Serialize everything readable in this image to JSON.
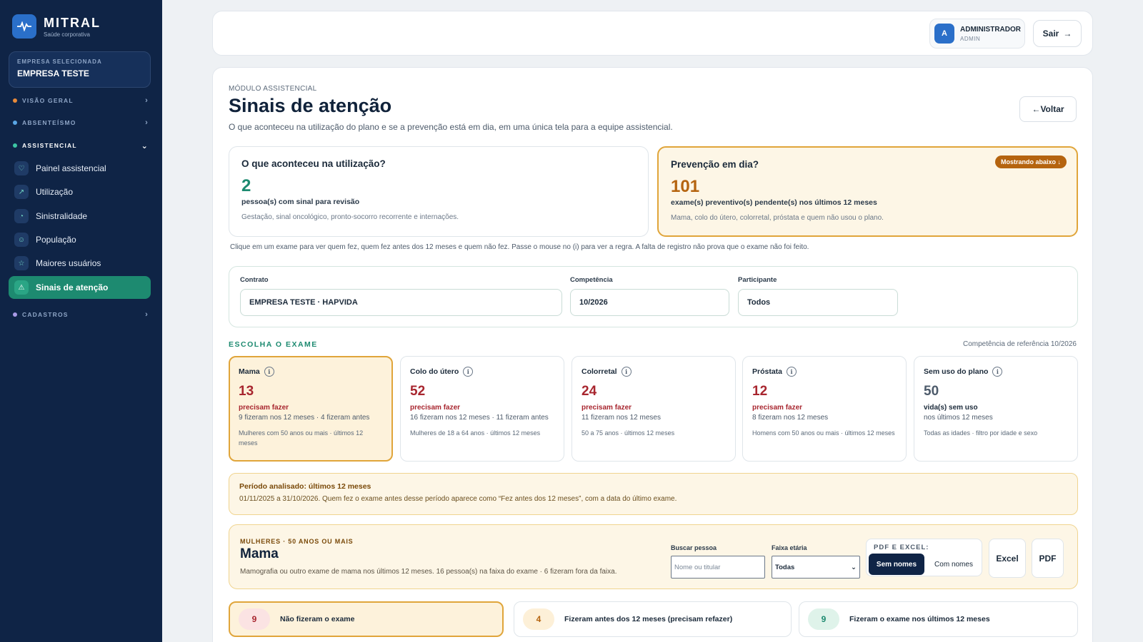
{
  "brand": {
    "name": "MITRAL",
    "subtitle": "Saúde corporativa"
  },
  "company": {
    "caption": "EMPRESA SELECIONADA",
    "name": "EMPRESA TESTE"
  },
  "nav": {
    "sections": {
      "visao_geral": "VISÃO GERAL",
      "absenteismo": "ABSENTEÍSMO",
      "assistencial": "ASSISTENCIAL",
      "cadastros": "CADASTROS"
    },
    "items": [
      {
        "label": "Painel assistencial",
        "icon": "heart-shield-icon"
      },
      {
        "label": "Utilização",
        "icon": "trend-icon"
      },
      {
        "label": "Sinistralidade",
        "icon": "pie-icon"
      },
      {
        "label": "População",
        "icon": "people-icon"
      },
      {
        "label": "Maiores usuários",
        "icon": "star-icon"
      },
      {
        "label": "Sinais de atenção",
        "icon": "warning-icon"
      }
    ]
  },
  "header": {
    "avatar": "A",
    "user": "ADMINISTRADOR",
    "role": "ADMIN",
    "logout": "Sair"
  },
  "page": {
    "module": "MÓDULO ASSISTENCIAL",
    "title": "Sinais de atenção",
    "description": "O que aconteceu na utilização do plano e se a prevenção está em dia, em uma única tela para a equipe assistencial.",
    "back": "Voltar"
  },
  "summary": {
    "util": {
      "title": "O que aconteceu na utilização?",
      "value": "2",
      "label": "pessoa(s) com sinal para revisão",
      "hint": "Gestação, sinal oncológico, pronto-socorro recorrente e internações."
    },
    "prev": {
      "title": "Prevenção em dia?",
      "badge": "Mostrando abaixo ↓",
      "value": "101",
      "label": "exame(s) preventivo(s) pendente(s) nos últimos 12 meses",
      "hint": "Mama, colo do útero, colorretal, próstata e quem não usou o plano."
    }
  },
  "instruction": "Clique em um exame para ver quem fez, quem fez antes dos 12 meses e quem não fez. Passe o mouse no (i) para ver a regra. A falta de registro não prova que o exame não foi feito.",
  "filters": {
    "contract_label": "Contrato",
    "contract_value": "EMPRESA TESTE · HAPVIDA",
    "competence_label": "Competência",
    "competence_value": "10/2026",
    "participant_label": "Participante",
    "participant_value": "Todos"
  },
  "exams_section": {
    "title": "ESCOLHA O EXAME",
    "reference": "Competência de referência 10/2026"
  },
  "exams": [
    {
      "name": "Mama",
      "value": "13",
      "need": "precisam fazer",
      "done": "9 fizeram nos 12 meses · 4 fizeram antes",
      "rule": "Mulheres com 50 anos ou mais · últimos 12 meses"
    },
    {
      "name": "Colo do útero",
      "value": "52",
      "need": "precisam fazer",
      "done": "16 fizeram nos 12 meses · 11 fizeram antes",
      "rule": "Mulheres de 18 a 64 anos · últimos 12 meses"
    },
    {
      "name": "Colorretal",
      "value": "24",
      "need": "precisam fazer",
      "done": "11 fizeram nos 12 meses",
      "rule": "50 a 75 anos · últimos 12 meses"
    },
    {
      "name": "Próstata",
      "value": "12",
      "need": "precisam fazer",
      "done": "8 fizeram nos 12 meses",
      "rule": "Homens com 50 anos ou mais · últimos 12 meses"
    },
    {
      "name": "Sem uso do plano",
      "value": "50",
      "need": "vida(s) sem uso",
      "done": "nos últimos 12 meses",
      "rule": "Todas as idades · filtro por idade e sexo"
    }
  ],
  "period": {
    "title": "Período analisado: últimos 12 meses",
    "text": "01/11/2025 a 31/10/2026. Quem fez o exame antes desse período aparece como “Fez antes dos 12 meses”, com a data do último exame."
  },
  "detail": {
    "caption": "MULHERES · 50 ANOS OU MAIS",
    "title": "Mama",
    "description": "Mamografia ou outro exame de mama nos últimos 12 meses. 16 pessoa(s) na faixa do exame · 6 fizeram fora da faixa.",
    "search_label": "Buscar pessoa",
    "search_placeholder": "Nome ou titular",
    "age_label": "Faixa etária",
    "age_value": "Todas",
    "export_caption": "PDF E EXCEL:",
    "without_names": "Sem nomes",
    "with_names": "Com nomes",
    "excel": "Excel",
    "pdf": "PDF"
  },
  "results": [
    {
      "count": "9",
      "label": "Não fizeram o exame"
    },
    {
      "count": "4",
      "label": "Fizeram antes dos 12 meses (precisam refazer)"
    },
    {
      "count": "9",
      "label": "Fizeram o exame nos últimos 12 meses"
    }
  ],
  "colors": {
    "sidebar": "#0f2446",
    "accent": "#1d8a70",
    "warning": "#e0a53a",
    "danger": "#a8262f"
  }
}
